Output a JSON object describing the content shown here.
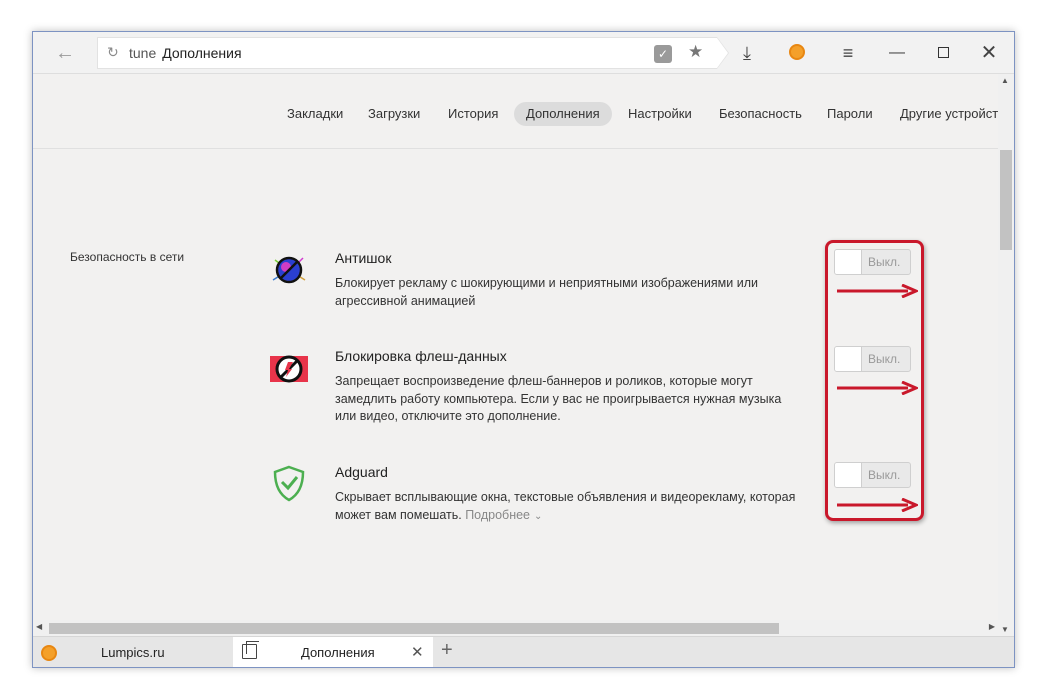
{
  "toolbar": {
    "back_icon": "back-arrow-icon",
    "url_proto": "tune",
    "url_title": "Дополнения"
  },
  "nav": {
    "items": [
      "Закладки",
      "Загрузки",
      "История",
      "Дополнения",
      "Настройки",
      "Безопасность",
      "Пароли",
      "Другие устройст"
    ],
    "active": "Дополнения"
  },
  "content": {
    "section_title": "Безопасность в сети",
    "extensions": [
      {
        "name": "Антишок",
        "description": "Блокирует рекламу с шокирующими и неприятными изображениями или агрессивной анимацией",
        "toggle_label": "Выкл.",
        "icon": "antishock-icon"
      },
      {
        "name": "Блокировка флеш-данных",
        "description": "Запрещает воспроизведение флеш-баннеров и роликов, которые могут замедлить работу компьютера. Если у вас не проигрывается нужная музыка или видео, отключите это дополнение.",
        "toggle_label": "Выкл.",
        "icon": "flash-block-icon"
      },
      {
        "name": "Adguard",
        "description": "Скрывает всплывающие окна, текстовые объявления и видеорекламу, которая может вам помешать.",
        "more_label": "Подробнее",
        "toggle_label": "Выкл.",
        "icon": "adguard-shield-icon"
      }
    ]
  },
  "tabs": [
    {
      "title": "Lumpics.ru",
      "active": false
    },
    {
      "title": "Дополнения",
      "active": true
    }
  ],
  "colors": {
    "annotation_red": "#c9182b",
    "active_tab_bg": "#dcdcdc",
    "page_bg": "#f2f1f0"
  }
}
